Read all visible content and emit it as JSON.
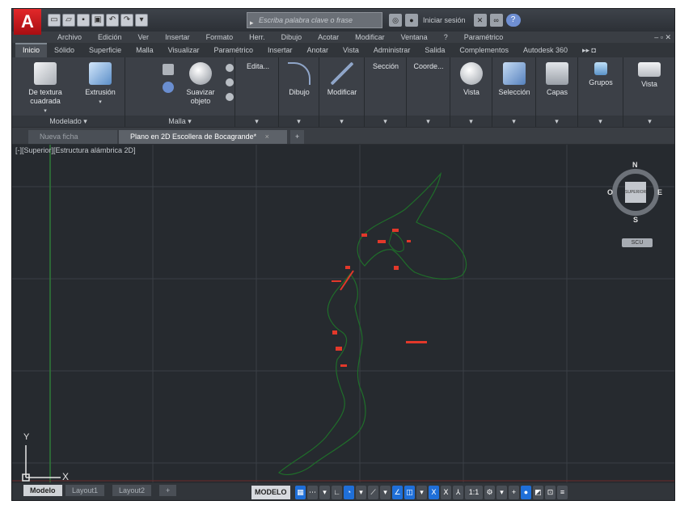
{
  "app": {
    "logo_letter": "A",
    "search_placeholder": "Escriba palabra clave o frase",
    "login_label": "Iniciar sesión",
    "help_label": "?"
  },
  "menubar": {
    "items": [
      "Archivo",
      "Edición",
      "Ver",
      "Insertar",
      "Formato",
      "Herr.",
      "Dibujo",
      "Acotar",
      "Modificar",
      "Ventana",
      "?",
      "Paramétrico"
    ],
    "window_controls": "– ▫ ✕"
  },
  "ribbon_tabs": {
    "items": [
      "Inicio",
      "Sólido",
      "Superficie",
      "Malla",
      "Visualizar",
      "Paramétrico",
      "Insertar",
      "Anotar",
      "Vista",
      "Administrar",
      "Salida",
      "Complementos",
      "Autodesk 360"
    ],
    "active_index": 0
  },
  "ribbon": {
    "panels": {
      "modelado": {
        "label": "Modelado",
        "buttons": [
          "De textura cuadrada",
          "Extrusión"
        ]
      },
      "malla": {
        "label": "Malla",
        "buttons": [
          "Suavizar objeto"
        ]
      },
      "edicion": {
        "label": "Edita..."
      },
      "dibujo": {
        "label": "Dibujo"
      },
      "modificar": {
        "label": "Modificar"
      },
      "seccion": {
        "label": "Sección"
      },
      "coordenadas": {
        "label": "Coorde..."
      },
      "vista1": {
        "label": "Vista"
      },
      "seleccion": {
        "label": "Selección"
      },
      "capas": {
        "label": "Capas"
      },
      "grupos": {
        "label": "Grupos"
      },
      "vista2": {
        "label": "Vista"
      }
    },
    "panel_arrow": "▾"
  },
  "doc_tabs": {
    "items": [
      {
        "label": "Nueva ficha",
        "active": false
      },
      {
        "label": "Plano en 2D Escollera de Bocagrande*",
        "active": true
      }
    ],
    "close_glyph": "×",
    "new_tab_glyph": "+"
  },
  "canvas": {
    "view_label": "[-][Superior][Estructura alámbrica 2D]",
    "ucs_y": "Y",
    "ucs_x": "X",
    "compass": {
      "north": "N",
      "south": "S",
      "east": "E",
      "west": "O",
      "face": "SUPERIOR"
    },
    "wcs_label": "SCU"
  },
  "layout_tabs": {
    "items": [
      "Modelo",
      "Layout1",
      "Layout2"
    ],
    "active_index": 0,
    "plus": "+"
  },
  "statusbar": {
    "model_label": "MODELO",
    "icons": [
      "grid-icon",
      "snap-icon",
      "ortho-icon",
      "polar-icon",
      "osnap-icon",
      "otrack-icon",
      "dynucs-icon",
      "annotation-icon",
      "workspace-icon",
      "isolate-icon",
      "fullscreen-icon",
      "customize-icon"
    ],
    "annotation_scale": "1:1"
  },
  "colors": {
    "canvas_bg": "#262a2f",
    "outline_green": "#1f6e2a",
    "accent_red": "#e2382a",
    "status_blue": "#1f6fd8"
  }
}
